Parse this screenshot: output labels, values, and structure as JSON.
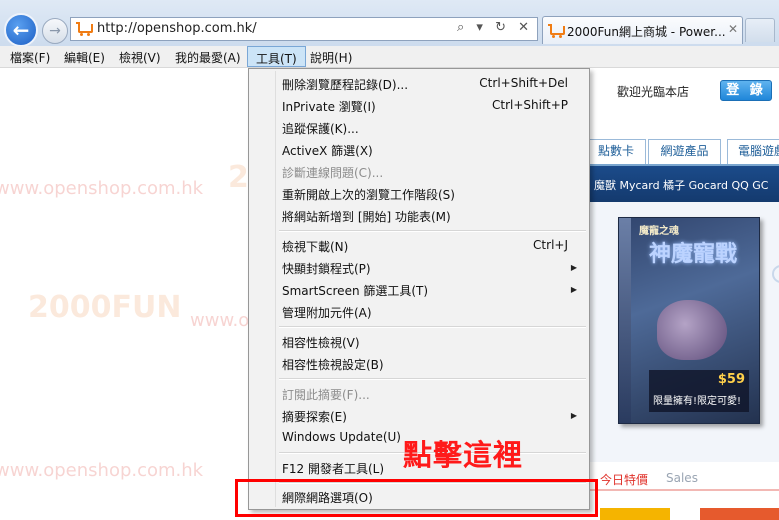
{
  "browser": {
    "address_url": "http://openshop.com.hk/",
    "address_icons": "⌕ ▾ ↻ ✕",
    "tab_title": "2000Fun網上商城 - Power...",
    "tab_close": "✕",
    "back_glyph": "←",
    "forward_glyph": "→"
  },
  "menubar": {
    "items": [
      "檔案(F)",
      "編輯(E)",
      "檢視(V)",
      "我的最愛(A)",
      "工具(T)",
      "說明(H)"
    ],
    "active_index": 4
  },
  "tools_menu": {
    "items": [
      {
        "label": "刪除瀏覽歷程記錄(D)...",
        "shortcut": "Ctrl+Shift+Del"
      },
      {
        "label": "InPrivate 瀏覽(I)",
        "shortcut": "Ctrl+Shift+P"
      },
      {
        "label": "追蹤保護(K)..."
      },
      {
        "label": "ActiveX 篩選(X)"
      },
      {
        "label": "診斷連線問題(C)...",
        "disabled": true
      },
      {
        "label": "重新開啟上次的瀏覽工作階段(S)"
      },
      {
        "label": "將網站新增到 [開始] 功能表(M)"
      },
      {
        "label": "檢視下載(N)",
        "shortcut": "Ctrl+J"
      },
      {
        "label": "快顯封鎖程式(P)",
        "submenu": true
      },
      {
        "label": "SmartScreen 篩選工具(T)",
        "submenu": true
      },
      {
        "label": "管理附加元件(A)"
      },
      {
        "label": "相容性檢視(V)"
      },
      {
        "label": "相容性檢視設定(B)"
      },
      {
        "label": "訂閱此摘要(F)...",
        "disabled": true
      },
      {
        "label": "摘要探索(E)",
        "submenu": true
      },
      {
        "label": "Windows Update(U)"
      },
      {
        "label": "F12 開發者工具(L)"
      },
      {
        "label": "網際網路選項(O)"
      }
    ],
    "submenu_arrow": "▶"
  },
  "annotation": {
    "text": "點擊這裡",
    "color": "#ff0000"
  },
  "page": {
    "welcome": "歡迎光臨本店",
    "login_button": "登 錄",
    "tabs": [
      "點數卡",
      "網遊產品",
      "電腦遊戲"
    ],
    "strip_text": "魔獸 Mycard 橘子 Gocard QQ GC",
    "product": {
      "title": "魔寵之魂",
      "logo": "神魔寵戰",
      "price": "$59",
      "slogan": "限量擁有!限定可愛!"
    },
    "sale_tabs": [
      "今日特價",
      "Sales"
    ],
    "watermark_text": "www.openshop.com.hk",
    "watermark_logo": "2000FUN"
  },
  "colors": {
    "accent_blue": "#1f86d9",
    "menu_highlight": "#cce4f7",
    "annotation_red": "#ff0000"
  }
}
